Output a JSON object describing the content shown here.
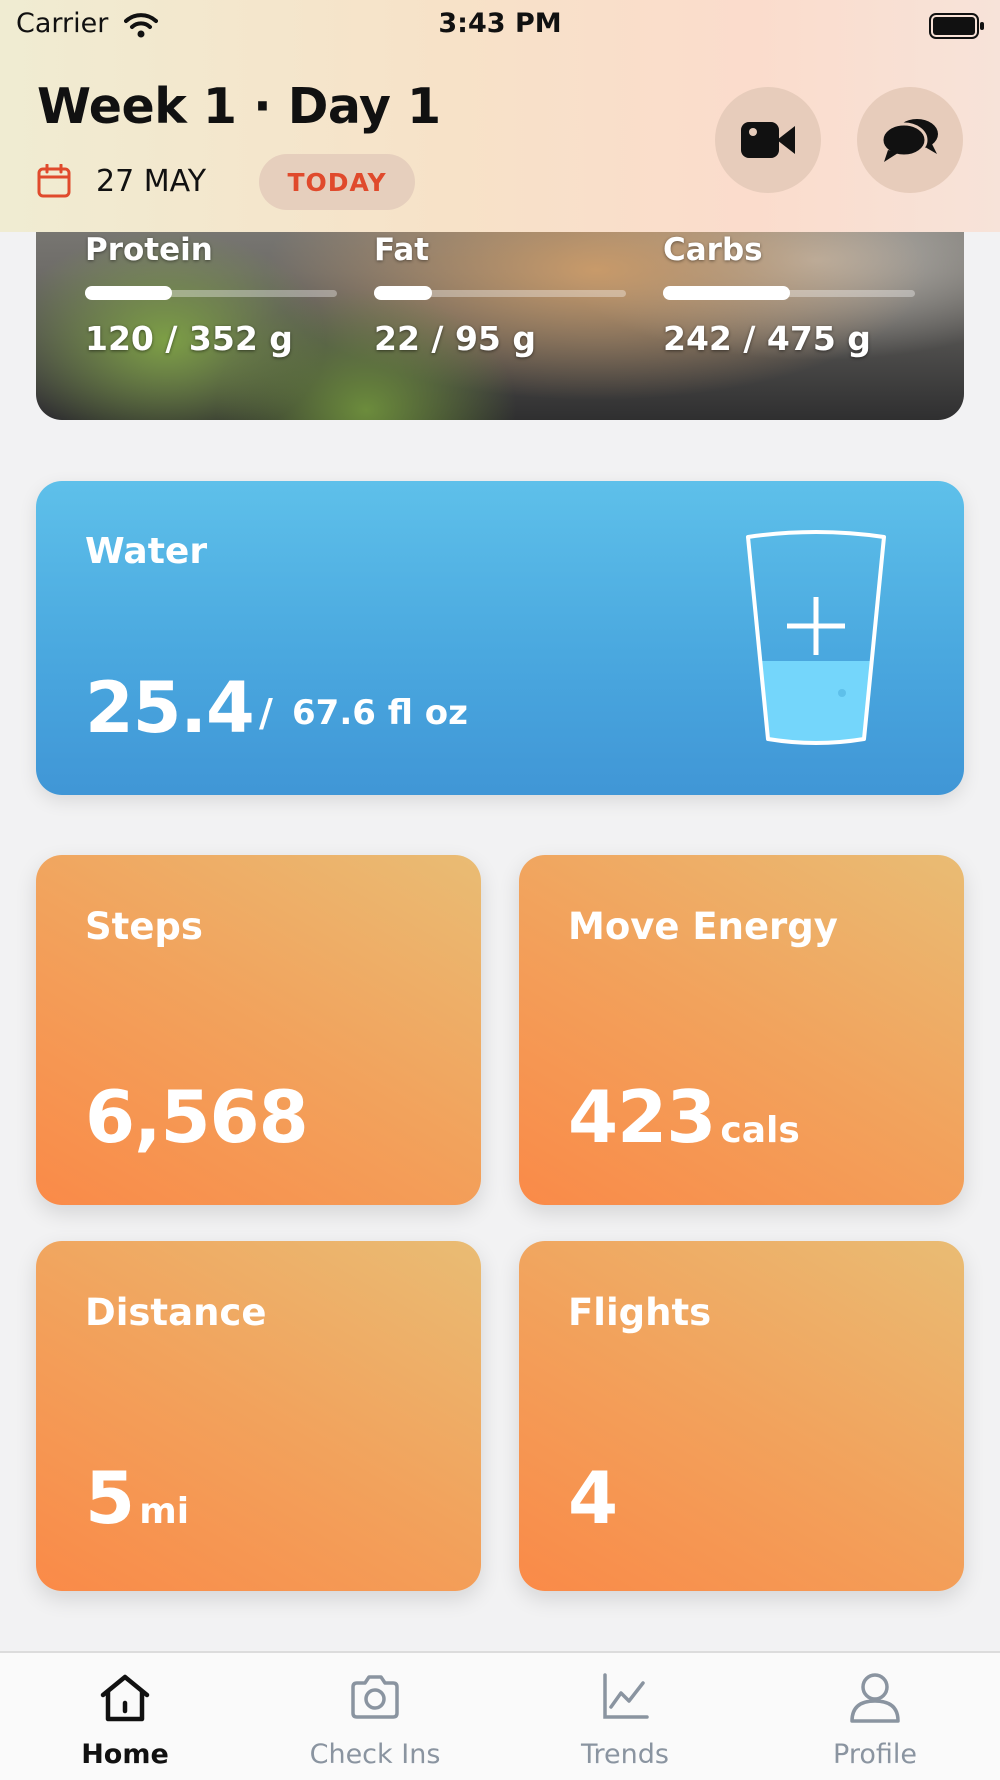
{
  "status_bar": {
    "carrier": "Carrier",
    "time": "3:43 PM"
  },
  "header": {
    "title": "Week 1 · Day 1",
    "date": "27 MAY",
    "today_label": "TODAY",
    "icons": [
      "calendar-icon",
      "video-icon",
      "chat-icon"
    ]
  },
  "macros": [
    {
      "label": "Protein",
      "value": "120 / 352 g",
      "current": 120,
      "goal": 352
    },
    {
      "label": "Fat",
      "value": "22 / 95 g",
      "current": 22,
      "goal": 95
    },
    {
      "label": "Carbs",
      "value": "242 / 475 g",
      "current": 242,
      "goal": 475
    }
  ],
  "water": {
    "title": "Water",
    "amount": "25.4",
    "separator": "/",
    "goal": "67.6 fl oz",
    "fill_fraction": 0.376
  },
  "stats": {
    "steps": {
      "title": "Steps",
      "value": "6,568",
      "unit": ""
    },
    "move_energy": {
      "title": "Move Energy",
      "value": "423",
      "unit": "cals"
    },
    "distance": {
      "title": "Distance",
      "value": "5",
      "unit": "mi"
    },
    "flights": {
      "title": "Flights",
      "value": "4",
      "unit": ""
    }
  },
  "tabs": [
    {
      "label": "Home",
      "active": true
    },
    {
      "label": "Check Ins",
      "active": false
    },
    {
      "label": "Trends",
      "active": false
    },
    {
      "label": "Profile",
      "active": false
    }
  ],
  "colors": {
    "accent_red": "#e04a2c",
    "water_blue": "#4aa8df",
    "stat_orange": "#f59a55"
  }
}
